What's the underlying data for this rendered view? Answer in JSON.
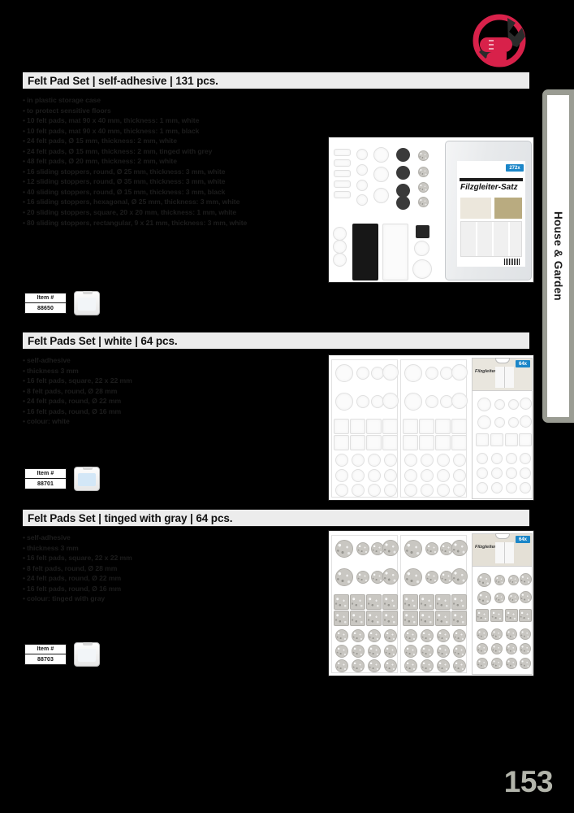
{
  "page": {
    "number": "153",
    "side_tab_label": "House & Garden",
    "logo_name": "fist-with-wrench-logo"
  },
  "sections": [
    {
      "title": "Felt Pad Set | self-adhesive | 131 pcs.",
      "bullets": [
        "in plastic storage case",
        "to protect sensitive floors",
        "10 felt pads, mat 90 x 40 mm, thickness: 1 mm, white",
        "10 felt pads, mat 90 x 40 mm, thickness: 1 mm, black",
        "24 felt pads, Ø 15 mm, thickness: 2 mm, white",
        "24 felt pads, Ø 15 mm, thickness: 2 mm, tinged with grey",
        "48 felt pads, Ø 20 mm, thickness: 2 mm, white",
        "16 sliding stoppers, round, Ø 25 mm, thickness: 3 mm, white",
        "12 sliding stoppers, round, Ø 35 mm, thickness: 3 mm, white",
        "40 sliding stoppers, round, Ø 15 mm, thickness: 3 mm, black",
        "16 sliding stoppers, hexagonal, Ø 25 mm, thickness: 3 mm, white",
        "20 sliding stoppers, square, 20 x 20 mm, thickness: 1 mm, white",
        "80 sliding stoppers, rectangular, 9 x 21 mm, thickness: 3 mm, white"
      ],
      "item_label": "Item #",
      "item_number": "88650",
      "package_title": "Filzgleiter-Satz",
      "package_badge": "272x"
    },
    {
      "title": "Felt Pads Set | white | 64 pcs.",
      "bullets": [
        "self-adhesive",
        "thickness 3 mm",
        "16 felt pads, square, 22 x 22 mm",
        "8 felt pads, round, Ø 28 mm",
        "24 felt pads, round, Ø 22 mm",
        "16 felt pads, round, Ø 16 mm",
        "colour: white"
      ],
      "item_label": "Item #",
      "item_number": "88701",
      "package_title": "Filzgleiter-Satz",
      "package_badge": "64x"
    },
    {
      "title": "Felt Pads Set | tinged with gray | 64 pcs.",
      "bullets": [
        "self-adhesive",
        "thickness 3 mm",
        "16 felt pads, square, 22 x 22 mm",
        "8 felt pads, round, Ø 28 mm",
        "24 felt pads, round, Ø 22 mm",
        "16 felt pads, round, Ø 16 mm",
        "colour: tinged with gray"
      ],
      "item_label": "Item #",
      "item_number": "88703",
      "package_title": "Filzgleiter-Satz",
      "package_badge": "64x"
    }
  ],
  "colors": {
    "accent_red": "#d8214a",
    "tab_gray": "#9a9c93",
    "title_bg": "#ececec",
    "badge_blue": "#1b86c8",
    "page_number": "#b3b5ab"
  }
}
